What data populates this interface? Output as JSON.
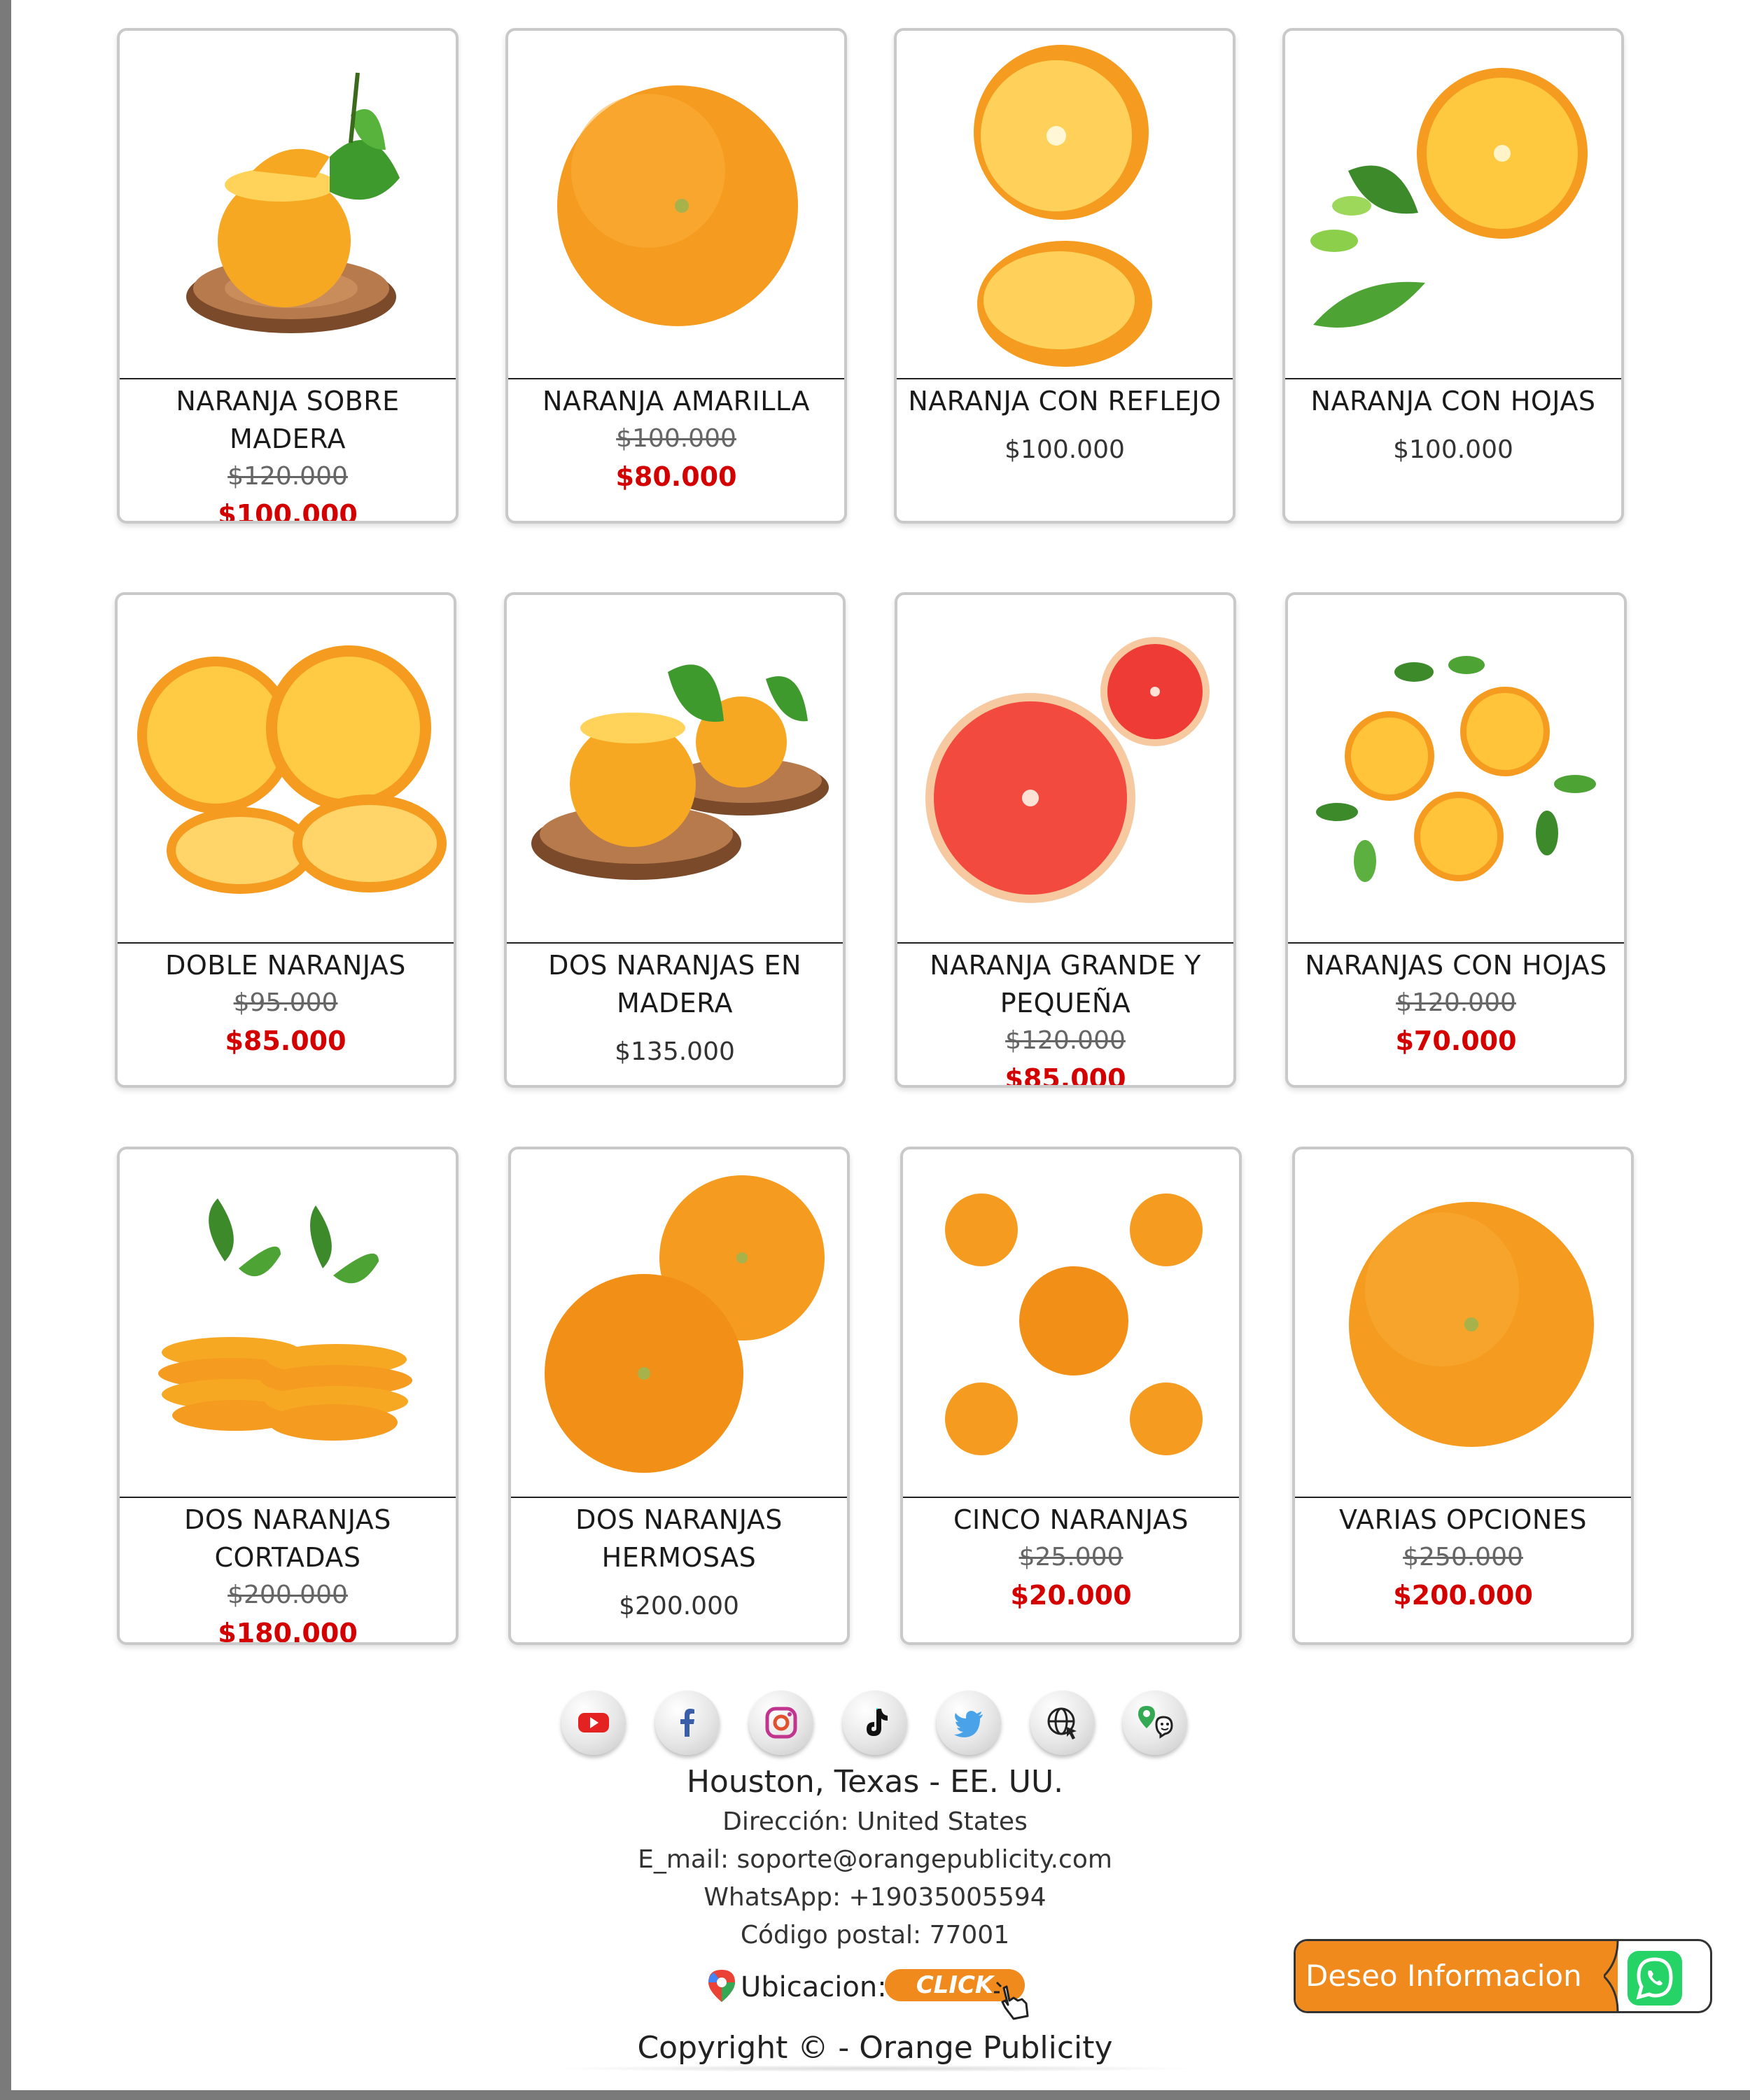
{
  "products": [
    {
      "name": "NARANJA SOBRE MADERA",
      "old_price": "$120.000",
      "price": "$100.000"
    },
    {
      "name": "NARANJA AMARILLA",
      "old_price": "$100.000",
      "price": "$80.000"
    },
    {
      "name": "NARANJA CON REFLEJO",
      "old_price": "",
      "price": "$100.000"
    },
    {
      "name": "NARANJA CON HOJAS",
      "old_price": "",
      "price": "$100.000"
    },
    {
      "name": "DOBLE NARANJAS",
      "old_price": "$95.000",
      "price": "$85.000"
    },
    {
      "name": "DOS NARANJAS EN MADERA",
      "old_price": "",
      "price": "$135.000"
    },
    {
      "name": "NARANJA GRANDE Y PEQUEÑA",
      "old_price": "$120.000",
      "price": "$85.000"
    },
    {
      "name": "NARANJAS CON HOJAS",
      "old_price": "$120.000",
      "price": "$70.000"
    },
    {
      "name": "DOS NARANJAS CORTADAS",
      "old_price": "$200.000",
      "price": "$180.000"
    },
    {
      "name": "DOS NARANJAS HERMOSAS",
      "old_price": "",
      "price": "$200.000"
    },
    {
      "name": "CINCO NARANJAS",
      "old_price": "$25.000",
      "price": "$20.000"
    },
    {
      "name": "VARIAS OPCIONES",
      "old_price": "$250.000",
      "price": "$200.000"
    }
  ],
  "social_icons": [
    "youtube-icon",
    "facebook-icon",
    "instagram-icon",
    "tiktok-icon",
    "twitter-icon",
    "globe-icon",
    "google-maps-waze-icon"
  ],
  "footer": {
    "city": "Houston, Texas - EE. UU.",
    "address": "Dirección: United States",
    "email": "E_mail: soporte@orangepublicity.com",
    "whatsapp": "WhatsApp: +19035005594",
    "postal": "Código postal: 77001",
    "location_label": "Ubicacion:",
    "click_label": "CLICK",
    "copyright": "Copyright © - Orange Publicity"
  },
  "whatsapp_button": {
    "label": "Deseo Informacion"
  },
  "colors": {
    "accent": "#f08a1d",
    "sale_price": "#d40000",
    "whatsapp": "#25d366"
  }
}
